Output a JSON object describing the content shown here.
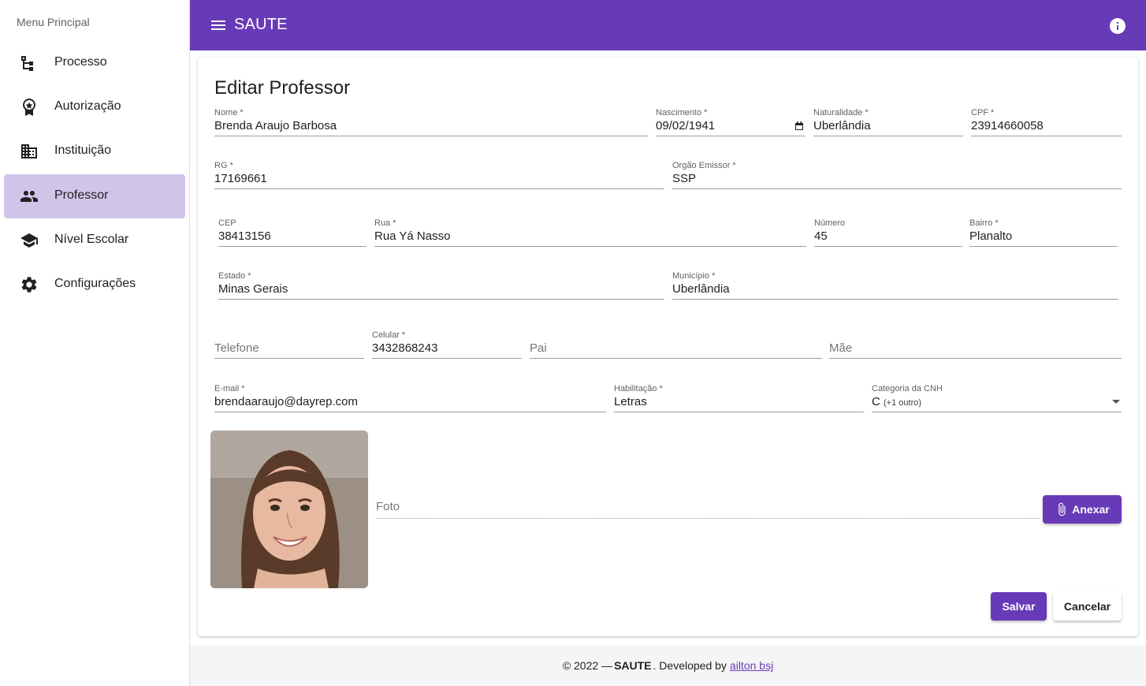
{
  "sidebar": {
    "title": "Menu Principal",
    "items": [
      {
        "label": "Processo",
        "icon": "account-tree-icon"
      },
      {
        "label": "Autorização",
        "icon": "award-icon"
      },
      {
        "label": "Instituição",
        "icon": "building-icon"
      },
      {
        "label": "Professor",
        "icon": "people-icon",
        "active": true
      },
      {
        "label": "Nível Escolar",
        "icon": "school-icon"
      },
      {
        "label": "Configurações",
        "icon": "gear-icon"
      }
    ]
  },
  "appbar": {
    "title": "SAUTE",
    "accent_color": "#673ab7"
  },
  "form": {
    "title": "Editar Professor",
    "nome": {
      "label": "Nome *",
      "value": "Brenda Araujo Barbosa"
    },
    "nascimento": {
      "label": "Nascimento *",
      "value": "09/02/1941"
    },
    "naturalidade": {
      "label": "Naturalidade *",
      "value": "Uberlândia"
    },
    "cpf": {
      "label": "CPF *",
      "value": "23914660058"
    },
    "rg": {
      "label": "RG *",
      "value": "17169661"
    },
    "orgao": {
      "label": "Orgão Emissor *",
      "value": "SSP"
    },
    "cep": {
      "label": "CEP",
      "value": "38413156"
    },
    "rua": {
      "label": "Rua *",
      "value": "Rua Yá Nasso"
    },
    "numero": {
      "label": "Número",
      "value": "45"
    },
    "bairro": {
      "label": "Bairro *",
      "value": "Planalto"
    },
    "estado": {
      "label": "Estado *",
      "value": "Minas Gerais"
    },
    "municipio": {
      "label": "Município *",
      "value": "Uberlândia"
    },
    "telefone": {
      "label": "Telefone",
      "value": ""
    },
    "celular": {
      "label": "Celular *",
      "value": "3432868243"
    },
    "pai": {
      "label": "Pai",
      "value": ""
    },
    "mae": {
      "label": "Mãe",
      "value": ""
    },
    "email": {
      "label": "E-mail *",
      "value": "brendaaraujo@dayrep.com"
    },
    "habilitacao": {
      "label": "Habilitação *",
      "value": "Letras"
    },
    "cnh": {
      "label": "Categoria da CNH",
      "value": "C",
      "extra": "(+1 outro)"
    },
    "foto": {
      "label": "Foto"
    },
    "anexar_label": "Anexar",
    "salvar_label": "Salvar",
    "cancelar_label": "Cancelar"
  },
  "footer": {
    "prefix": "© 2022 —",
    "brand": "SAUTE",
    "middle": ". Developed by",
    "author": "ailton bsj"
  }
}
